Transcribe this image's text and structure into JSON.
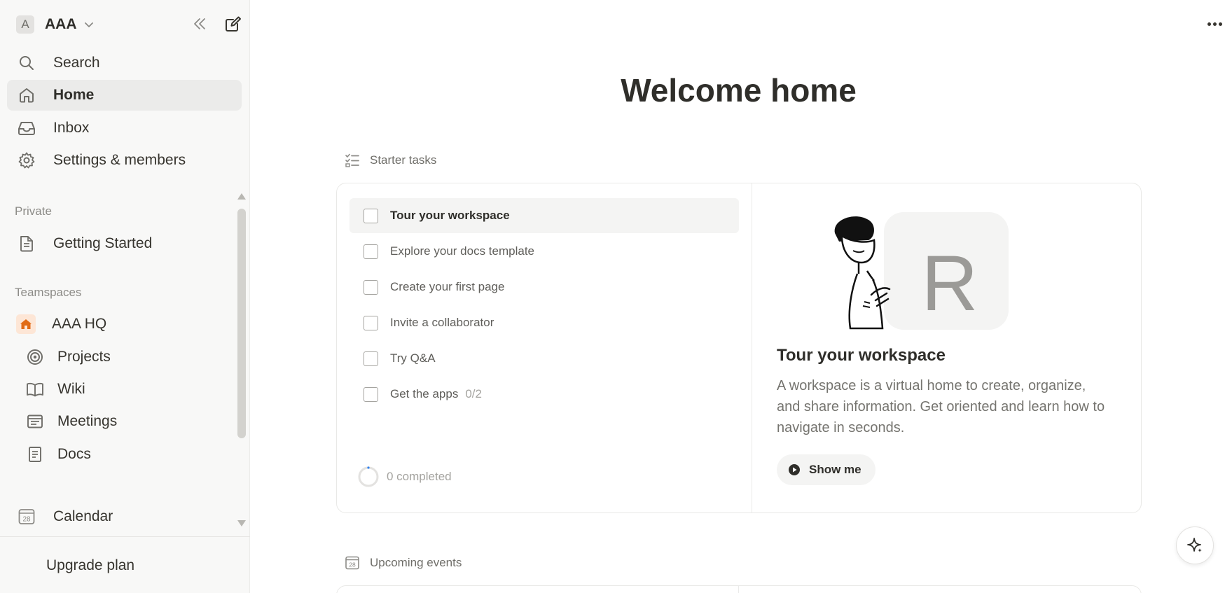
{
  "sidebar": {
    "workspace": {
      "avatar_letter": "A",
      "name": "AAA"
    },
    "nav": [
      {
        "label": "Search",
        "icon": "search-icon"
      },
      {
        "label": "Home",
        "icon": "home-icon",
        "active": true
      },
      {
        "label": "Inbox",
        "icon": "inbox-icon"
      },
      {
        "label": "Settings & members",
        "icon": "gear-icon"
      }
    ],
    "private_label": "Private",
    "private_items": [
      {
        "label": "Getting Started",
        "icon": "page-icon"
      }
    ],
    "teamspaces_label": "Teamspaces",
    "teamspace": {
      "label": "AAA HQ",
      "icon": "house-icon"
    },
    "teamspace_items": [
      {
        "label": "Projects",
        "icon": "target-icon"
      },
      {
        "label": "Wiki",
        "icon": "book-icon"
      },
      {
        "label": "Meetings",
        "icon": "calendar-note-icon"
      },
      {
        "label": "Docs",
        "icon": "doc-icon"
      }
    ],
    "calendar": {
      "label": "Calendar",
      "icon_text": "28"
    },
    "upgrade_label": "Upgrade plan"
  },
  "main": {
    "title": "Welcome home",
    "starter_tasks_label": "Starter tasks",
    "tasks": [
      {
        "label": "Tour your workspace",
        "active": true
      },
      {
        "label": "Explore your docs template"
      },
      {
        "label": "Create your first page"
      },
      {
        "label": "Invite a collaborator"
      },
      {
        "label": "Try Q&A"
      },
      {
        "label": "Get the apps",
        "count": "0/2"
      }
    ],
    "completed_label": "0 completed",
    "completed_fraction": 0,
    "detail": {
      "badge_letter": "R",
      "title": "Tour your workspace",
      "description": "A workspace is a virtual home to create, organize, and share information. Get oriented and learn how to navigate in seconds.",
      "button_label": "Show me"
    },
    "upcoming_events_label": "Upcoming events",
    "upcoming_icon_text": "28"
  },
  "colors": {
    "sidebar_bg": "#f8f8f7",
    "active_bg": "#ebebea",
    "text": "#37352f",
    "muted": "#8c8b87",
    "teamspace_accent": "#e16b16",
    "progress_accent": "#2f80ed"
  }
}
